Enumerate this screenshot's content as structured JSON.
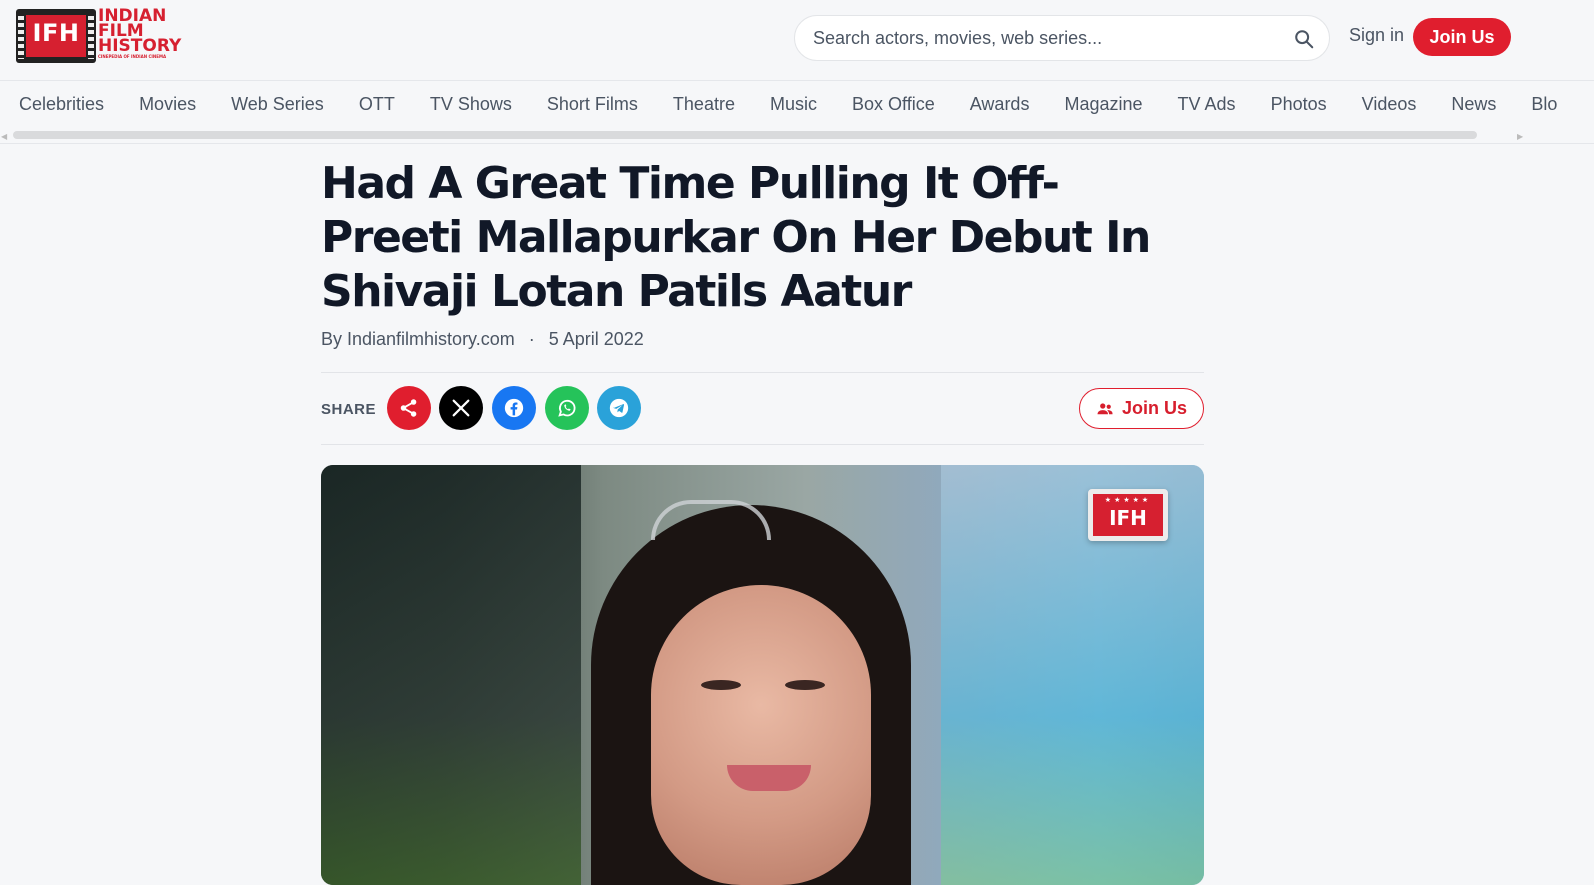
{
  "header": {
    "logo": {
      "mark": "IFH",
      "line1": "INDIAN",
      "line2": "FILM",
      "line3": "HISTORY",
      "tagline": "CINEPEDIA OF INDIAN CINEMA"
    },
    "search": {
      "placeholder": "Search actors, movies, web series..."
    },
    "signin_label": "Sign in",
    "join_label": "Join Us",
    "accent_color": "#e01e2e"
  },
  "nav": {
    "items": [
      "Celebrities",
      "Movies",
      "Web Series",
      "OTT",
      "TV Shows",
      "Short Films",
      "Theatre",
      "Music",
      "Box Office",
      "Awards",
      "Magazine",
      "TV Ads",
      "Photos",
      "Videos",
      "News",
      "Blo"
    ]
  },
  "article": {
    "title": "Had A Great Time Pulling It Off- Preeti Mallapurkar On Her Debut In Shivaji Lotan Patils Aatur",
    "author": "By Indianfilmhistory.com",
    "date": "5 April 2022",
    "share_label": "SHARE",
    "share_buttons": [
      {
        "icon": "share-icon",
        "color": "#e01e2e"
      },
      {
        "icon": "x-icon",
        "color": "#000000"
      },
      {
        "icon": "facebook-icon",
        "color": "#1877f2"
      },
      {
        "icon": "whatsapp-icon",
        "color": "#25c35a"
      },
      {
        "icon": "telegram-icon",
        "color": "#2aa2d9"
      }
    ],
    "join_label": "Join Us",
    "hero_badge": "IFH"
  }
}
